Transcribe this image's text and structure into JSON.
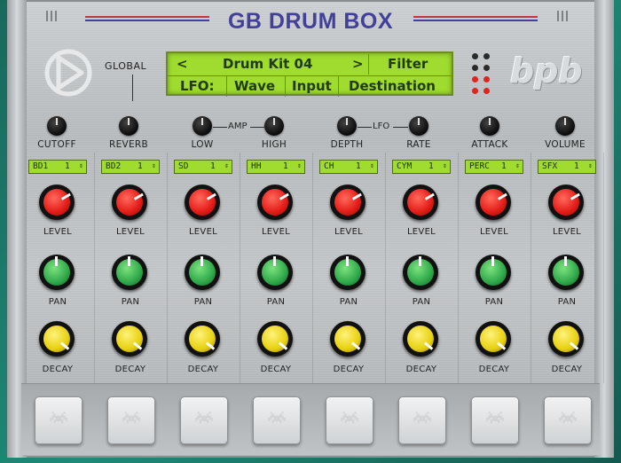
{
  "title": "GB DRUM BOX",
  "global_label": "GLOBAL",
  "brand_logo": "bpb",
  "lcd": {
    "row1": {
      "prev": "<",
      "kit": "Drum Kit 04",
      "next": ">",
      "right": "Filter"
    },
    "row2": {
      "lfo": "LFO:",
      "wave": "Wave",
      "input": "Input",
      "destination": "Destination"
    }
  },
  "global_knobs": {
    "cutoff": "CUTOFF",
    "reverb": "REVERB",
    "low": "LOW",
    "high": "HIGH",
    "depth": "DEPTH",
    "rate": "RATE",
    "attack": "ATTACK",
    "volume": "VOLUME"
  },
  "groups": {
    "amp": "AMP",
    "lfo": "LFO"
  },
  "channels": [
    {
      "name": "BD1",
      "value": "1"
    },
    {
      "name": "BD2",
      "value": "1"
    },
    {
      "name": "SD",
      "value": "1"
    },
    {
      "name": "HH",
      "value": "1"
    },
    {
      "name": "CH",
      "value": "1"
    },
    {
      "name": "CYM",
      "value": "1"
    },
    {
      "name": "PERC",
      "value": "1"
    },
    {
      "name": "SFX",
      "value": "1"
    }
  ],
  "channel_knob_labels": {
    "level": "LEVEL",
    "pan": "PAN",
    "decay": "DECAY"
  },
  "colors": {
    "lcd": "#9fdc2f",
    "level": "#e31b17",
    "pan": "#2fa84a",
    "decay": "#e7d10f",
    "title": "#43409a"
  }
}
